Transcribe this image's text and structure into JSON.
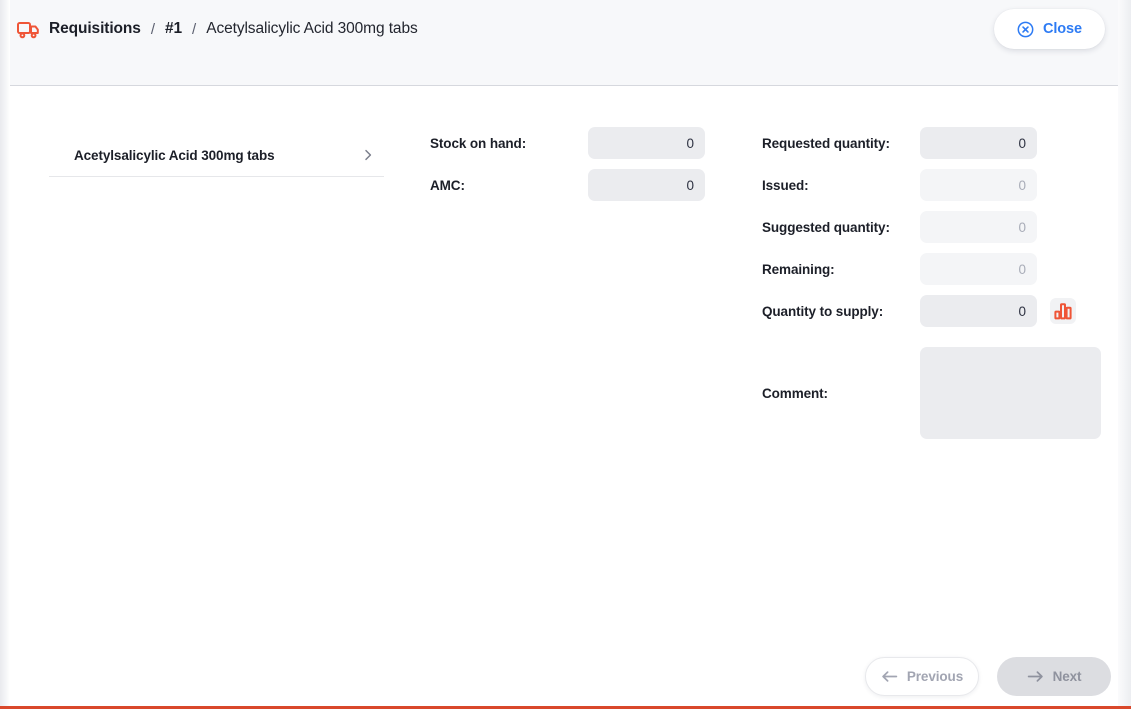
{
  "header": {
    "truck_icon": "truck-icon",
    "breadcrumb": {
      "root": "Requisitions",
      "separator_1": "/",
      "number": "#1",
      "separator_2": "/",
      "item": "Acetylsalicylic Acid 300mg tabs"
    },
    "close_button": {
      "label": "Close",
      "icon": "close-circle-icon",
      "color": "#2d7bf4"
    }
  },
  "item_list": [
    {
      "label": "Acetylsalicylic Acid 300mg tabs",
      "chevron": "chevron-right-icon"
    }
  ],
  "fields": {
    "middle": [
      {
        "label": "Stock on hand:",
        "value": "0",
        "disabled": false
      },
      {
        "label": "AMC:",
        "value": "0",
        "disabled": false
      }
    ],
    "right": [
      {
        "label": "Requested quantity:",
        "value": "0",
        "disabled": false
      },
      {
        "label": "Issued:",
        "value": "0",
        "disabled": true
      },
      {
        "label": "Suggested quantity:",
        "value": "0",
        "disabled": true
      },
      {
        "label": "Remaining:",
        "value": "0",
        "disabled": true
      },
      {
        "label": "Quantity to supply:",
        "value": "0",
        "disabled": false
      }
    ],
    "comment": {
      "label": "Comment:",
      "value": "",
      "placeholder": ""
    },
    "chart_button": {
      "icon": "bar-chart-icon",
      "color": "#ef5537"
    }
  },
  "footer": {
    "previous": {
      "label": "Previous",
      "icon": "arrow-left-icon"
    },
    "next": {
      "label": "Next",
      "icon": "arrow-right-icon"
    }
  },
  "colors": {
    "accent_orange": "#d9482b",
    "link_blue": "#2d7bf4",
    "header_bg": "#f7f8fa",
    "input_bg": "#ebecef",
    "input_bg_disabled": "#f4f5f7"
  }
}
